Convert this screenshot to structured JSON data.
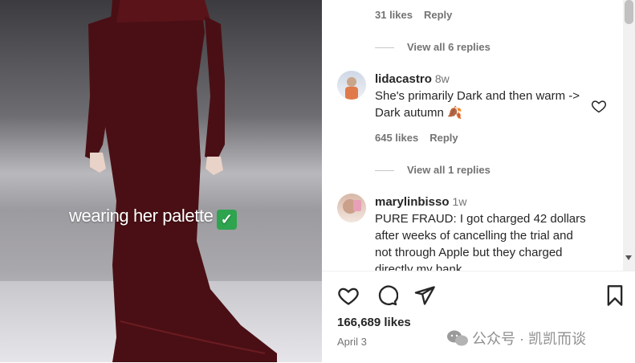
{
  "post": {
    "caption": "wearing her palette",
    "caption_emoji": "✓"
  },
  "comments": {
    "prev_reply": {
      "likes": "31 likes",
      "reply": "Reply"
    },
    "view_replies_1": "View all 6 replies",
    "items": [
      {
        "username": "lidacastro",
        "time": "8w",
        "text": "She's primarily Dark and then warm -> Dark autumn 🍂",
        "likes": "645 likes",
        "reply": "Reply",
        "view_replies": "View all 1 replies"
      },
      {
        "username": "marylinbisso",
        "time": "1w",
        "text": "PURE FRAUD: I got charged 42 dollars after weeks of cancelling the trial and not through Apple but they charged directly my bank"
      }
    ]
  },
  "actions": {
    "likes": "166,689 likes",
    "date": "April 3",
    "watermark": "公众号 · 凯凯而谈"
  }
}
